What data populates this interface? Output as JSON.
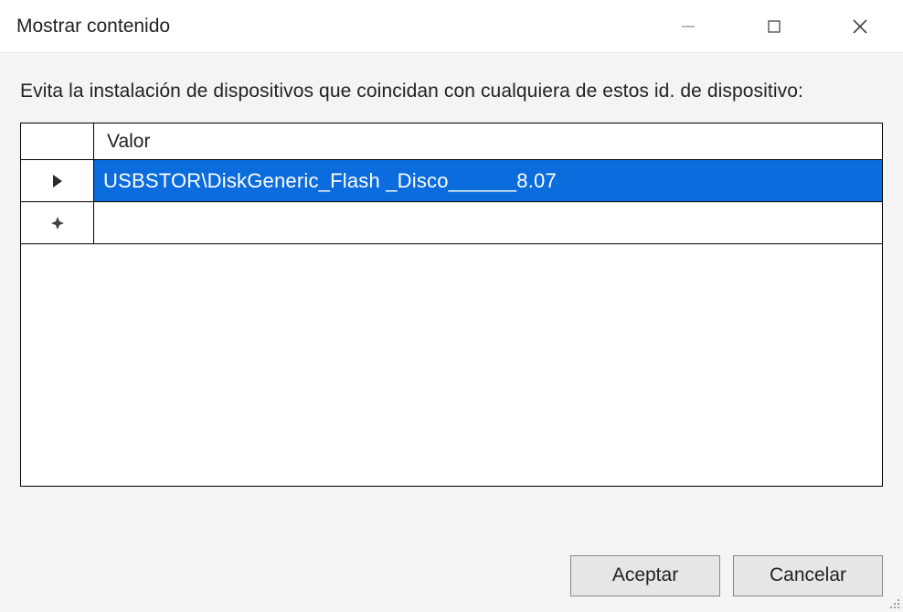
{
  "titlebar": {
    "title": "Mostrar contenido"
  },
  "description": "Evita la instalación de dispositivos que coincidan con cualquiera de estos id. de dispositivo:",
  "grid": {
    "column_header": "Valor",
    "rows": [
      {
        "indicator": "current",
        "selected": true,
        "value": "USBSTOR\\DiskGeneric_Flash _Disco______8.07"
      },
      {
        "indicator": "new",
        "selected": false,
        "value": ""
      }
    ]
  },
  "buttons": {
    "ok": "Aceptar",
    "cancel": "Cancelar"
  },
  "colors": {
    "selection": "#0b6cdd"
  }
}
